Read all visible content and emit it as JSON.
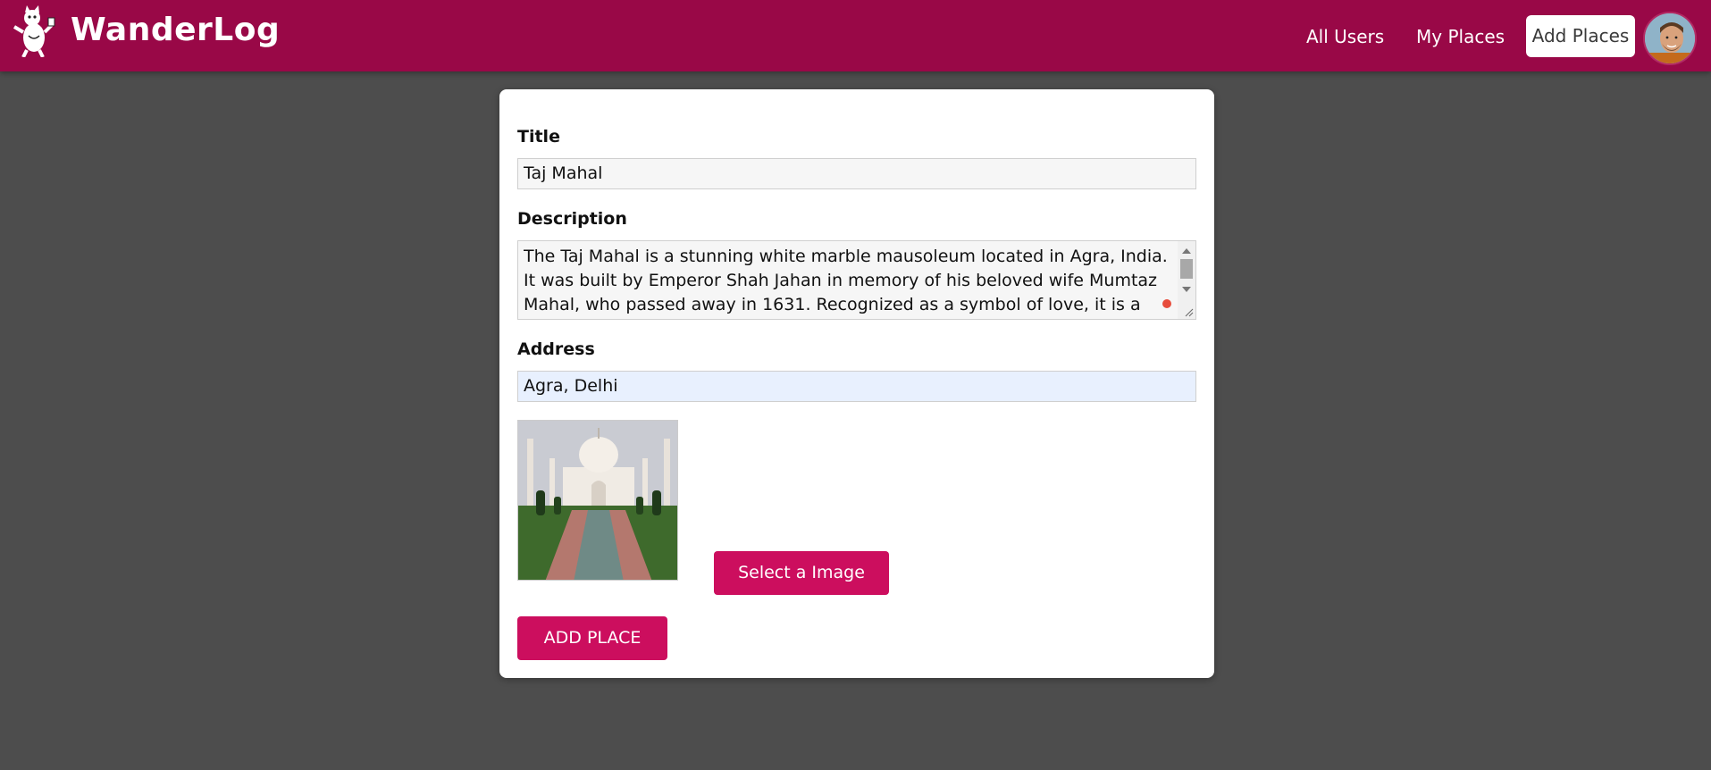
{
  "header": {
    "brand": "WanderLog",
    "nav": {
      "all_users": "All Users",
      "my_places": "My Places",
      "add_places": "Add Places"
    },
    "icons": {
      "logo": "cat-mascot-icon",
      "avatar": "user-avatar"
    },
    "color": "#990847"
  },
  "form": {
    "title_label": "Title",
    "title_value": "Taj Mahal",
    "description_label": "Description",
    "description_value": "The Taj Mahal is a stunning white marble mausoleum located in Agra, India. It was built by Emperor Shah Jahan in memory of his beloved wife Mumtaz Mahal, who passed away in 1631. Recognized as a symbol of love, it is a",
    "address_label": "Address",
    "address_value": "Agra, Delhi",
    "select_image_button": "Select a Image",
    "submit_button": "ADD PLACE",
    "accent_color": "#cc0e5e"
  }
}
